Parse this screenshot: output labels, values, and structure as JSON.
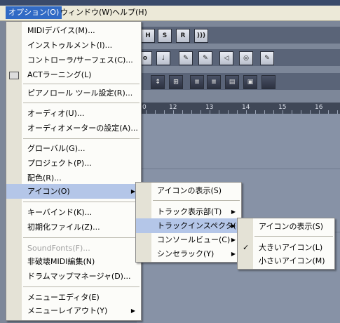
{
  "menubar": {
    "items": [
      {
        "label": "オプション(O)"
      },
      {
        "label": "ウィンドウ(W)"
      },
      {
        "label": "ヘルプ(H)"
      }
    ]
  },
  "background": {
    "transport_buttons": [
      "H",
      "S",
      "R"
    ],
    "ruler_ticks": [
      "0",
      "12",
      "13",
      "14",
      "15",
      "16"
    ]
  },
  "options_menu": {
    "items": [
      {
        "label": "MIDIデバイス(M)..."
      },
      {
        "label": "インストゥルメント(I)..."
      },
      {
        "label": "コントローラ/サーフェス(C)..."
      },
      {
        "label": "ACTラーニング(L)"
      },
      {
        "label": "ピアノロール ツール設定(R)..."
      },
      {
        "label": "オーディオ(U)..."
      },
      {
        "label": "オーディオメーターの設定(A)..."
      },
      {
        "label": "グローバル(G)..."
      },
      {
        "label": "プロジェクト(P)..."
      },
      {
        "label": "配色(R)..."
      },
      {
        "label": "アイコン(O)"
      },
      {
        "label": "キーバインド(K)..."
      },
      {
        "label": "初期化ファイル(Z)..."
      },
      {
        "label": "SoundFonts(F)..."
      },
      {
        "label": "非破壊MIDI編集(N)"
      },
      {
        "label": "ドラムマップマネージャ(D)..."
      },
      {
        "label": "メニューエディタ(E)"
      },
      {
        "label": "メニューレイアウト(Y)"
      }
    ]
  },
  "icons_submenu": {
    "items": [
      {
        "label": "アイコンの表示(S)"
      },
      {
        "label": "トラック表示部(T)"
      },
      {
        "label": "トラックインスペクタ(I)"
      },
      {
        "label": "コンソールビュー(C)"
      },
      {
        "label": "シンセラック(Y)"
      }
    ]
  },
  "inspector_submenu": {
    "items": [
      {
        "label": "アイコンの表示(S)"
      },
      {
        "label": "大きいアイコン(L)",
        "checked": true
      },
      {
        "label": "小さいアイコン(M)"
      }
    ]
  },
  "glyphs": {
    "submenu_arrow": "▶",
    "checkmark": "✓"
  }
}
